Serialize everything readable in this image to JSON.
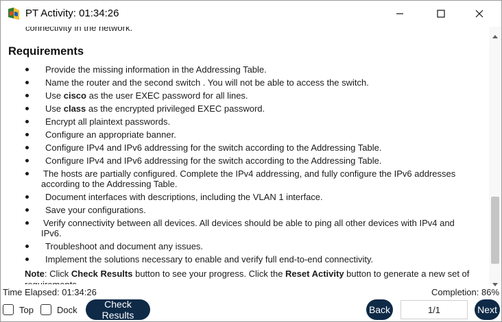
{
  "window": {
    "title": "PT Activity: 01:34:26",
    "icon": "packet-tracer-icon",
    "controls": [
      "minimize-icon",
      "maximize-icon",
      "close-icon"
    ]
  },
  "content": {
    "cut_line": "connectivity in the network.",
    "section_title": "Requirements",
    "requirements": [
      "Provide the missing information in the Addressing Table.",
      "Name the router and the second switch . You will not be able to access the switch.",
      "Use cisco as the user EXEC password for all lines.",
      "Use class as the encrypted privileged EXEC password.",
      "Encrypt all plaintext passwords.",
      "Configure an appropriate banner.",
      "Configure IPv4 and IPv6 addressing for the switch according to the Addressing Table.",
      "Configure IPv4 and IPv6 addressing for the switch according to the Addressing Table.",
      "The hosts are partially configured. Complete the IPv4 addressing, and fully configure the IPv6 addresses according to the Addressing Table.",
      "Document interfaces with descriptions, including the VLAN 1 interface.",
      "Save your configurations.",
      "Verify connectivity between all devices. All devices should be able to ping all other devices with IPv4 and IPv6.",
      "Troubleshoot and document any issues.",
      "Implement the solutions necessary to enable and verify full end-to-end connectivity."
    ],
    "req_bold": {
      "r3_pre": "Use ",
      "r3_bold": "cisco",
      "r3_post": " as the user EXEC password for all lines.",
      "r4_pre": "Use ",
      "r4_bold": "class",
      "r4_post": " as the encrypted privileged EXEC password."
    },
    "note": {
      "label": "Note",
      "t1": ": Click ",
      "b1": "Check Results",
      "t2": " button to see your progress. Click the ",
      "b2": "Reset Activity",
      "t3": " button to generate a new set of requirements."
    }
  },
  "status": {
    "time_elapsed": "Time Elapsed: 01:34:26",
    "completion": "Completion: 86%"
  },
  "toolbar": {
    "top_label": "Top",
    "dock_label": "Dock",
    "check_results": "Check Results",
    "back": "Back",
    "page": "1/1",
    "next": "Next",
    "button_color": "#0e2a47"
  }
}
